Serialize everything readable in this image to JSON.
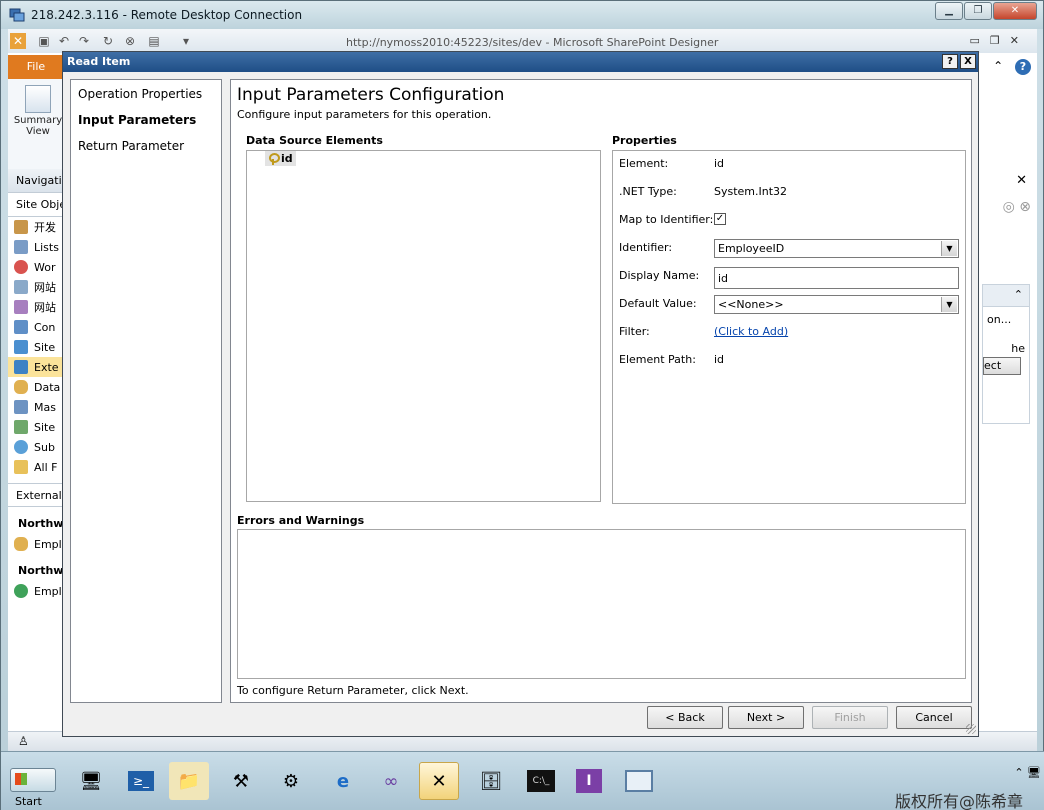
{
  "rdc": {
    "title": "218.242.3.116 - Remote Desktop Connection"
  },
  "spd": {
    "title": "http://nymoss2010:45223/sites/dev  -  Microsoft SharePoint Designer",
    "file_tab": "File",
    "ribbon_button": "Summary View",
    "nav_header": "Navigati",
    "site_objects": "Site Obje",
    "nav_items": [
      "开发",
      "Lists",
      "Wor",
      "网站",
      "网站",
      "Con",
      "Site",
      "Exte",
      "Data",
      "Mas",
      "Site",
      "Sub",
      "All F"
    ],
    "external_header": "External",
    "group1": "Northw",
    "group1_item": "Employ",
    "group2": "Northw",
    "group2_item": "Employ",
    "right_pane_text": "on...",
    "right_pane_text2": "he",
    "right_pane_button": "ect"
  },
  "dialog": {
    "title": "Read Item",
    "help": "?",
    "close": "X",
    "nav": [
      "Operation Properties",
      "Input Parameters",
      "Return Parameter"
    ],
    "main_title": "Input Parameters Configuration",
    "main_subtitle": "Configure input parameters for this operation.",
    "dse_label": "Data Source Elements",
    "tree_node": "id",
    "props_label": "Properties",
    "properties": {
      "element_label": "Element:",
      "element_value": "id",
      "net_type_label": ".NET Type:",
      "net_type_value": "System.Int32",
      "map_label": "Map to Identifier:",
      "map_checked": "✓",
      "identifier_label": "Identifier:",
      "identifier_value": "EmployeeID",
      "display_name_label": "Display Name:",
      "display_name_value": "id",
      "default_value_label": "Default Value:",
      "default_value_value": "<<None>>",
      "filter_label": "Filter:",
      "filter_link": "(Click to Add)",
      "element_path_label": "Element Path:",
      "element_path_value": "id"
    },
    "errors_label": "Errors and Warnings",
    "footer_note": "To configure Return Parameter, click Next.",
    "buttons": {
      "back": "< Back",
      "next": "Next >",
      "finish": "Finish",
      "cancel": "Cancel"
    }
  },
  "taskbar": {
    "start": "Start",
    "watermark": "版权所有@陈希章"
  }
}
